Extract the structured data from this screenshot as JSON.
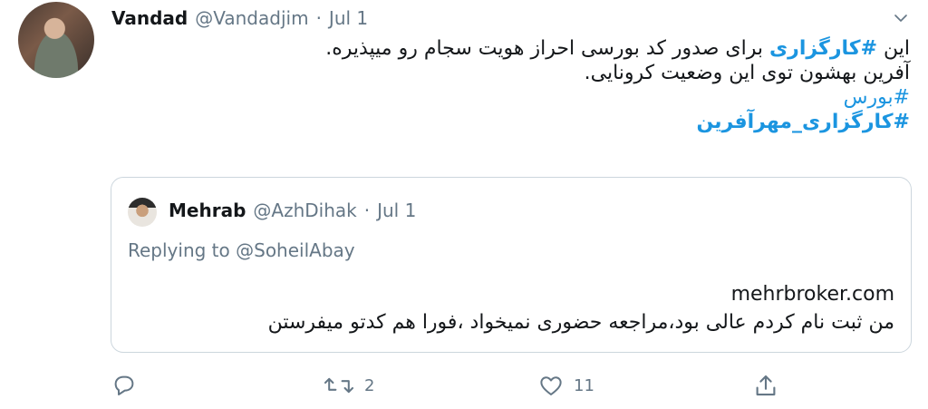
{
  "tweet": {
    "author_name": "Vandad",
    "author_handle": "@Vandadjim",
    "separator": "·",
    "date": "Jul 1",
    "line1_prefix": "این ",
    "line1_hashtag": "#کارگزاری",
    "line1_rest": " برای صدور کد بورسی احراز هویت سجام رو میپذیره.",
    "line2": "آفرین بهشون توی این وضعیت کرونایی.",
    "hashtag_1": "#بورس",
    "hashtag_2": "#کارگزاری_مهرآفرین"
  },
  "quoted": {
    "author_name": "Mehrab",
    "author_handle": "@AzhDihak",
    "separator": "·",
    "date": "Jul 1",
    "replying_label": "Replying to",
    "replying_handle": "@SoheilAbay",
    "line1": "mehrbroker.com",
    "line2": "من ثبت نام کردم عالی بود،مراجعه حضوری نمیخواد ،فورا هم کدتو میفرستن"
  },
  "actions": {
    "reply_icon": "reply-icon",
    "retweet_icon": "retweet-icon",
    "retweet_count": "2",
    "like_icon": "heart-icon",
    "like_count": "11",
    "share_icon": "share-icon"
  },
  "colors": {
    "link": "#1b95e0",
    "muted": "#657786",
    "text": "#14171a",
    "border": "#ccd6dd"
  }
}
